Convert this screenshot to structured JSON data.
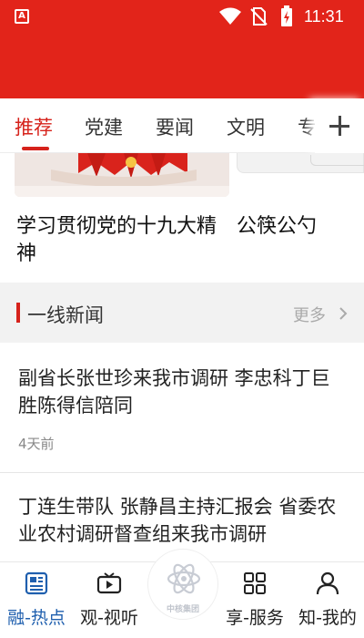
{
  "status_bar": {
    "time": "11:31",
    "app_icon_letter": "A"
  },
  "colors": {
    "brand_red": "#e2241a",
    "accent_red": "#d6221b",
    "nav_active_blue": "#1f5fae"
  },
  "tabs": [
    {
      "label": "推荐",
      "active": true
    },
    {
      "label": "党建",
      "active": false
    },
    {
      "label": "要闻",
      "active": false
    },
    {
      "label": "文明",
      "active": false
    },
    {
      "label": "专",
      "active": false
    }
  ],
  "tabs_add_icon": "plus-icon",
  "carousel": {
    "captions": [
      "学习贯彻党的十九大精神",
      "公筷公勺"
    ]
  },
  "section": {
    "title": "一线新闻",
    "more_label": "更多"
  },
  "news": [
    {
      "title": "副省长张世珍来我市调研  李忠科丁巨胜陈得信陪同",
      "time": "4天前"
    },
    {
      "title": "丁连生带队  张静昌主持汇报会  省委农业农村调研督查组来我市调研"
    }
  ],
  "bottom_nav": {
    "items": [
      {
        "label": "融-热点",
        "icon": "newspaper-icon",
        "active": true
      },
      {
        "label": "观-视听",
        "icon": "video-icon",
        "active": false
      },
      {
        "label": "享-服务",
        "icon": "grid-icon",
        "active": false
      },
      {
        "label": "知-我的",
        "icon": "user-icon",
        "active": false
      }
    ],
    "center_logo_text": "中核集团"
  }
}
